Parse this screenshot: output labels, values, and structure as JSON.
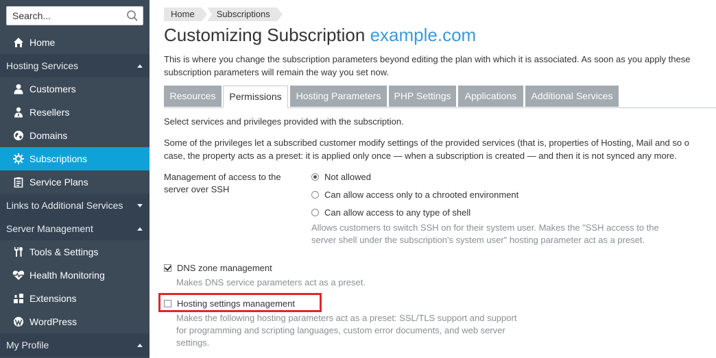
{
  "sidebar": {
    "search_placeholder": "Search...",
    "items": [
      {
        "type": "item",
        "label": "Home",
        "icon": "home-icon"
      },
      {
        "type": "section",
        "label": "Hosting Services",
        "caret": "up"
      },
      {
        "type": "item",
        "label": "Customers",
        "icon": "user-icon"
      },
      {
        "type": "item",
        "label": "Resellers",
        "icon": "reseller-icon"
      },
      {
        "type": "item",
        "label": "Domains",
        "icon": "globe-icon"
      },
      {
        "type": "item",
        "label": "Subscriptions",
        "icon": "gear-icon",
        "active": true
      },
      {
        "type": "item",
        "label": "Service Plans",
        "icon": "clipboard-icon"
      },
      {
        "type": "section",
        "label": "Links to Additional Services",
        "caret": "down"
      },
      {
        "type": "section",
        "label": "Server Management",
        "caret": "up"
      },
      {
        "type": "item",
        "label": "Tools & Settings",
        "icon": "tools-icon"
      },
      {
        "type": "item",
        "label": "Health Monitoring",
        "icon": "heart-pulse-icon"
      },
      {
        "type": "item",
        "label": "Extensions",
        "icon": "puzzle-icon"
      },
      {
        "type": "item",
        "label": "WordPress",
        "icon": "wordpress-icon"
      },
      {
        "type": "section",
        "label": "My Profile",
        "caret": "up"
      }
    ]
  },
  "breadcrumb": [
    "Home",
    "Subscriptions"
  ],
  "page": {
    "title_prefix": "Customizing Subscription",
    "title_domain": "example.com",
    "intro_line1": "This is where you change the subscription parameters beyond editing the plan with which it is associated. As soon as you apply these",
    "intro_line2": "subscription parameters will remain the way you set now."
  },
  "tabs": [
    {
      "label": "Resources",
      "active": false
    },
    {
      "label": "Permissions",
      "active": true
    },
    {
      "label": "Hosting Parameters",
      "active": false
    },
    {
      "label": "PHP Settings",
      "active": false
    },
    {
      "label": "Applications",
      "active": false
    },
    {
      "label": "Additional Services",
      "active": false
    }
  ],
  "permissions": {
    "select_text": "Select services and privileges provided with the subscription.",
    "note_line1": "Some of the privileges let a subscribed customer modify settings of the provided services (that is, properties of Hosting, Mail and so o",
    "note_line2": "case, the property acts as a preset: it is applied only once — when a subscription is created — and then it is not synced any more.",
    "ssh_label": "Management of access to the server over SSH",
    "ssh_options": [
      {
        "label": "Not allowed",
        "selected": true
      },
      {
        "label": "Can allow access only to a chrooted environment",
        "selected": false
      },
      {
        "label": "Can allow access to any type of shell",
        "selected": false
      }
    ],
    "ssh_hint": "Allows customers to switch SSH on for their system user. Makes the \"SSH access to the server shell under the subscription's system user\" hosting parameter act as a preset.",
    "dns_label": "DNS zone management",
    "dns_checked": true,
    "dns_hint": "Makes DNS service parameters act as a preset.",
    "hosting_label": "Hosting settings management",
    "hosting_checked": false,
    "hosting_hint": "Makes the following hosting parameters act as a preset: SSL/TLS support and support for programming and scripting languages, custom error documents, and web server settings."
  },
  "colors": {
    "sidebar_bg": "#3c4a58",
    "active_item": "#0fa2d9",
    "domain_link": "#3a9ad9",
    "highlight_box": "#e2252b"
  }
}
